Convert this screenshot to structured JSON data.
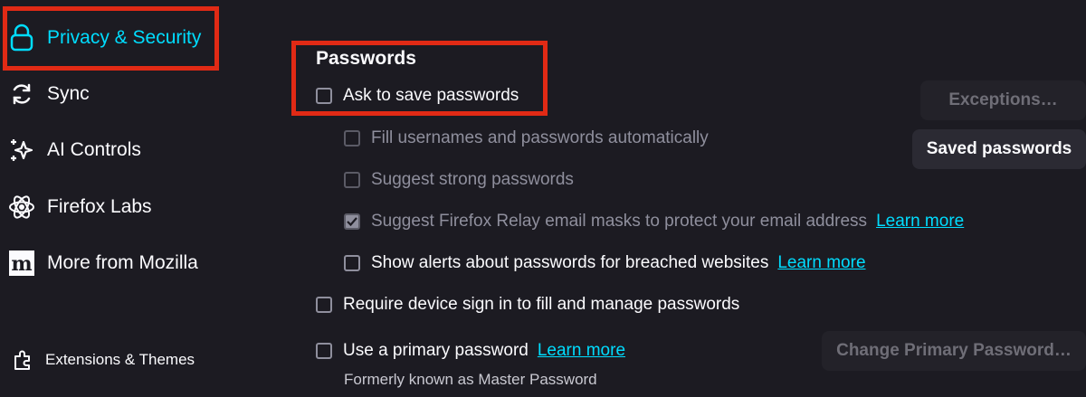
{
  "sidebar": {
    "items": [
      {
        "label": "Privacy & Security"
      },
      {
        "label": "Sync"
      },
      {
        "label": "AI Controls"
      },
      {
        "label": "Firefox Labs"
      },
      {
        "label": "More from Mozilla"
      }
    ],
    "extensions_label": "Extensions & Themes"
  },
  "passwords": {
    "title": "Passwords",
    "ask_to_save": {
      "label": "Ask to save passwords",
      "checked": false
    },
    "fill_automatically": {
      "label": "Fill usernames and passwords automatically",
      "checked": false
    },
    "suggest_strong": {
      "label": "Suggest strong passwords",
      "checked": false
    },
    "relay_masks": {
      "label": "Suggest Firefox Relay email masks to protect your email address",
      "checked": true,
      "link": "Learn more"
    },
    "breach_alerts": {
      "label": "Show alerts about passwords for breached websites",
      "checked": false,
      "link": "Learn more"
    },
    "device_signin": {
      "label": "Require device sign in to fill and manage passwords",
      "checked": false
    },
    "primary_password": {
      "label": "Use a primary password",
      "checked": false,
      "link": "Learn more",
      "note": "Formerly known as Master Password"
    },
    "buttons": {
      "exceptions": "Exceptions…",
      "saved_passwords": "Saved passwords",
      "change_primary": "Change Primary Password…"
    }
  },
  "colors": {
    "background": "#1c1b22",
    "accent": "#00ddff",
    "highlight": "#e12a15"
  }
}
